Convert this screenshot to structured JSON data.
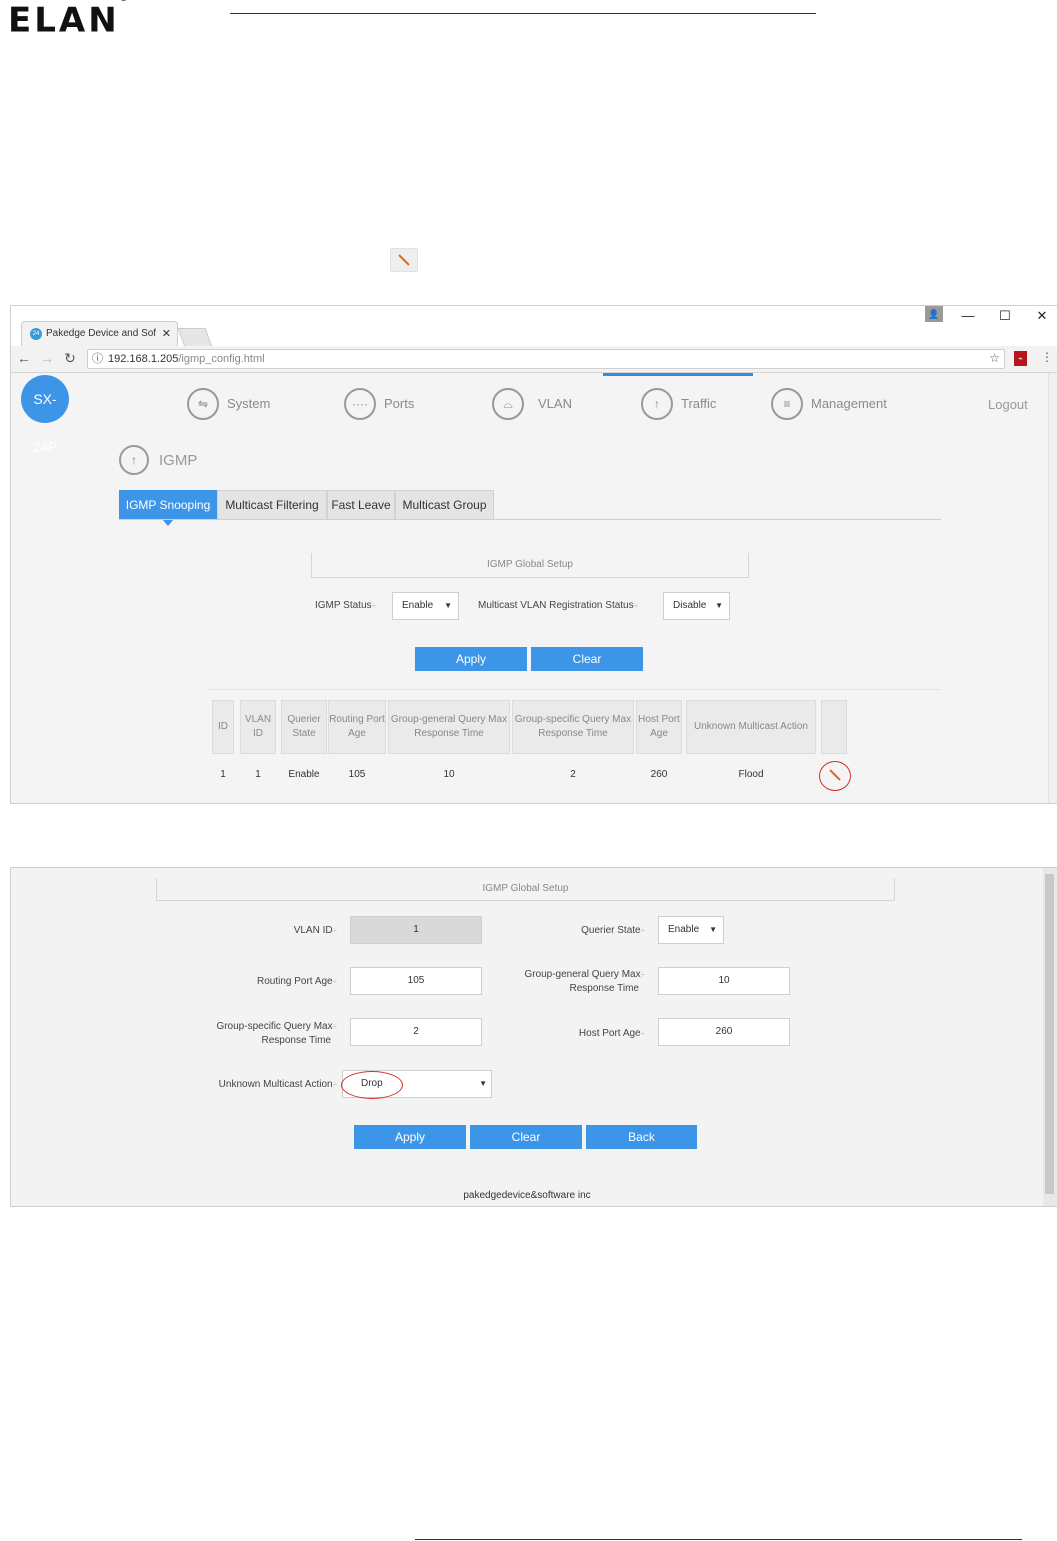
{
  "header": {
    "logo_text": "ELAN",
    "logo_mark": "®"
  },
  "browser": {
    "tab_title": "Pakedge Device and Soft",
    "tab_favicon": "24",
    "url_host": "192.168.1.205",
    "url_path": "/igmp_config.html",
    "window_controls": {
      "user": "👤",
      "min": "—",
      "max": "☐",
      "close": "✕"
    }
  },
  "app": {
    "device_badge": "SX-24P",
    "menu": [
      {
        "label": "System",
        "icon": "system-icon"
      },
      {
        "label": "Ports",
        "icon": "ports-icon"
      },
      {
        "label": "VLAN",
        "icon": "vlan-icon"
      },
      {
        "label": "Traffic",
        "icon": "traffic-icon"
      },
      {
        "label": "Management",
        "icon": "management-icon"
      }
    ],
    "logout": "Logout",
    "section_title": "IGMP",
    "tabs": [
      "IGMP Snooping",
      "Multicast Filtering",
      "Fast Leave",
      "Multicast Group"
    ],
    "global_setup_title": "IGMP Global Setup",
    "igmp_status_label": "IGMP Status",
    "igmp_status_value": "Enable",
    "mvr_status_label": "Multicast VLAN Registration Status",
    "mvr_status_value": "Disable",
    "apply": "Apply",
    "clear": "Clear",
    "table": {
      "headers": [
        "ID",
        "VLAN ID",
        "Querier State",
        "Routing Port Age",
        "Group-general Query Max Response Time",
        "Group-specific Query Max Response Time",
        "Host Port Age",
        "Unknown Multicast Action",
        ""
      ],
      "row": [
        "1",
        "1",
        "Enable",
        "105",
        "10",
        "2",
        "260",
        "Flood"
      ]
    }
  },
  "edit_form": {
    "title": "IGMP Global Setup",
    "vlan_id_label": "VLAN ID",
    "vlan_id_value": "1",
    "querier_state_label": "Querier State",
    "querier_state_value": "Enable",
    "routing_port_age_label": "Routing Port Age",
    "routing_port_age_value": "105",
    "gg_query_label_1": "Group-general Query Max",
    "gg_query_label_2": "Response Time",
    "gg_query_value": "10",
    "gs_query_label_1": "Group-specific Query Max",
    "gs_query_label_2": "Response Time",
    "gs_query_value": "2",
    "host_port_age_label": "Host Port Age",
    "host_port_age_value": "260",
    "unknown_mc_label": "Unknown Multicast Action",
    "unknown_mc_value": "Drop",
    "apply": "Apply",
    "clear": "Clear",
    "back": "Back",
    "footer": "pakedgedevice&software inc"
  },
  "colors": {
    "accent": "#3d95e8",
    "highlight_ring": "#d32f2f",
    "edit_icon": "#e2621b"
  }
}
